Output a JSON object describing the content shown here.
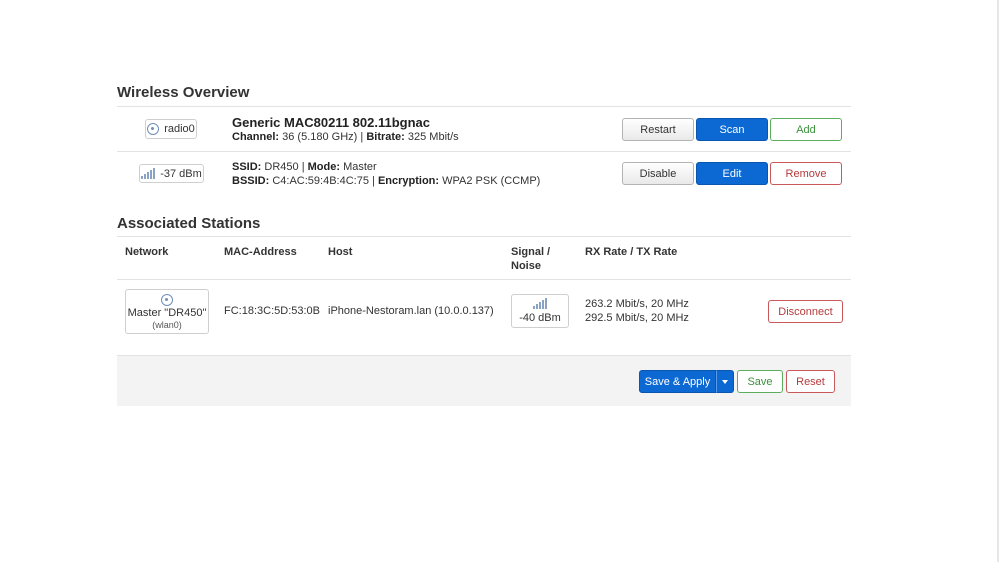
{
  "wireless_overview": {
    "title": "Wireless Overview",
    "device": {
      "badge": "radio0",
      "name": "Generic MAC80211 802.11bgnac",
      "channel_label": "Channel:",
      "channel_value": "36 (5.180 GHz)",
      "sep1": "|",
      "bitrate_label": "Bitrate:",
      "bitrate_value": "325 Mbit/s",
      "buttons": {
        "restart": "Restart",
        "scan": "Scan",
        "add": "Add"
      }
    },
    "network": {
      "signal": "-37 dBm",
      "ssid_label": "SSID:",
      "ssid_value": "DR450",
      "sep1": "|",
      "mode_label": "Mode:",
      "mode_value": "Master",
      "bssid_label": "BSSID:",
      "bssid_value": "C4:AC:59:4B:4C:75",
      "sep2": "|",
      "encryption_label": "Encryption:",
      "encryption_value": "WPA2 PSK (CCMP)",
      "buttons": {
        "disable": "Disable",
        "edit": "Edit",
        "remove": "Remove"
      }
    }
  },
  "associated_stations": {
    "title": "Associated Stations",
    "columns": {
      "network": "Network",
      "mac": "MAC-Address",
      "host": "Host",
      "signal_1": "Signal /",
      "signal_2": "Noise",
      "rate": "RX Rate / TX Rate"
    },
    "rows": [
      {
        "network_line1": "Master \"DR450\"",
        "network_line2": "(wlan0)",
        "mac": "FC:18:3C:5D:53:0B",
        "host": "iPhone-Nestoram.lan (10.0.0.137)",
        "signal": "-40 dBm",
        "rx": "263.2 Mbit/s, 20 MHz",
        "tx": "292.5 Mbit/s, 20 MHz",
        "disconnect": "Disconnect"
      }
    ]
  },
  "footer": {
    "save_apply": "Save & Apply",
    "save": "Save",
    "reset": "Reset"
  },
  "colors": {
    "primary": "#0c69d4",
    "positive": "#3c8f3c",
    "negative": "#b33a3c"
  }
}
